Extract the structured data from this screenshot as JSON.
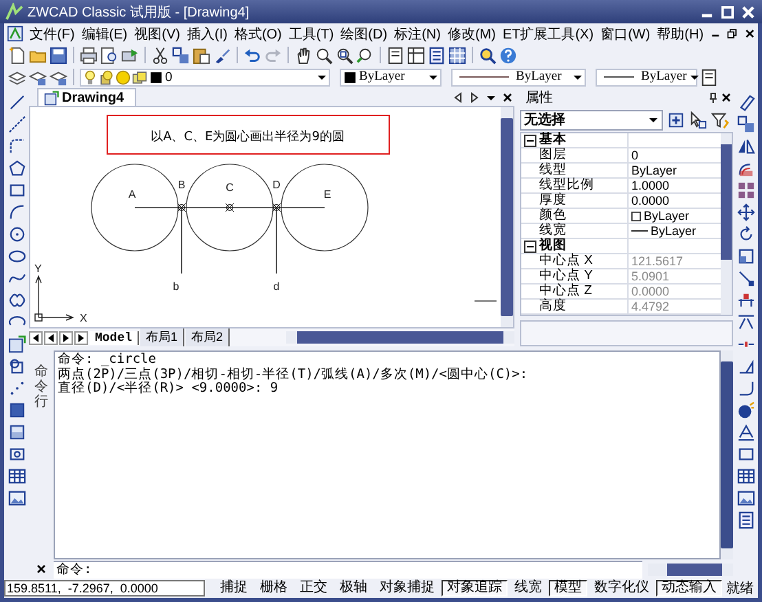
{
  "window": {
    "title": "ZWCAD Classic 试用版 - [Drawing4]"
  },
  "menu": [
    "文件(F)",
    "编辑(E)",
    "视图(V)",
    "插入(I)",
    "格式(O)",
    "工具(T)",
    "绘图(D)",
    "标注(N)",
    "修改(M)",
    "ET扩展工具(X)",
    "窗口(W)",
    "帮助(H)"
  ],
  "layer_toolbar": {
    "layer": "0",
    "color_setting": "ByLayer",
    "linetype": "ByLayer",
    "lineweight": "ByLayer"
  },
  "document_tab": {
    "title": "Drawing4"
  },
  "drawing": {
    "annotation": "以A、C、E为圆心画出半径为9的圆",
    "point_labels": [
      "A",
      "B",
      "C",
      "D",
      "E",
      "b",
      "d"
    ],
    "axis_labels": [
      "X",
      "Y"
    ]
  },
  "layout_tabs": [
    {
      "label": "Model",
      "selected": true
    },
    {
      "label": "布局1",
      "selected": false
    },
    {
      "label": "布局2",
      "selected": false
    }
  ],
  "properties": {
    "title": "属性",
    "selector": "无选择",
    "groups": [
      {
        "name": "基本",
        "expanded": true,
        "rows": [
          {
            "label": "图层",
            "value": "0",
            "kind": "text",
            "disabled": false
          },
          {
            "label": "线型",
            "value": "ByLayer",
            "kind": "text",
            "disabled": false
          },
          {
            "label": "线型比例",
            "value": "1.0000",
            "kind": "text",
            "disabled": false
          },
          {
            "label": "厚度",
            "value": "0.0000",
            "kind": "text",
            "disabled": false
          },
          {
            "label": "颜色",
            "value": "ByLayer",
            "kind": "color",
            "disabled": false
          },
          {
            "label": "线宽",
            "value": "ByLayer",
            "kind": "lineweight",
            "disabled": false
          }
        ]
      },
      {
        "name": "视图",
        "expanded": true,
        "rows": [
          {
            "label": "中心点 X",
            "value": "121.5617",
            "kind": "text",
            "disabled": true
          },
          {
            "label": "中心点 Y",
            "value": "5.0901",
            "kind": "text",
            "disabled": true
          },
          {
            "label": "中心点 Z",
            "value": "0.0000",
            "kind": "text",
            "disabled": true
          },
          {
            "label": "高度",
            "value": "4.4792",
            "kind": "text",
            "disabled": true
          }
        ]
      }
    ]
  },
  "command": {
    "panel_label": "命令行",
    "history": [
      "命令: _circle",
      "两点(2P)/三点(3P)/相切-相切-半径(T)/弧线(A)/多次(M)/<圆中心(C)>:",
      "直径(D)/<半径(R)> <9.0000>: 9"
    ],
    "prompt": "命令:"
  },
  "status_bar": {
    "coordinates": "159.8511,  -7.2967,  0.0000",
    "toggles": [
      {
        "label": "捕捉",
        "on": false
      },
      {
        "label": "栅格",
        "on": false
      },
      {
        "label": "正交",
        "on": false
      },
      {
        "label": "极轴",
        "on": false
      },
      {
        "label": "对象捕捉",
        "on": false
      },
      {
        "label": "对象追踪",
        "on": true
      },
      {
        "label": "线宽",
        "on": false
      },
      {
        "label": "模型",
        "on": true
      },
      {
        "label": "数字化仪",
        "on": false
      },
      {
        "label": "动态输入",
        "on": true
      }
    ],
    "state": "就绪"
  }
}
